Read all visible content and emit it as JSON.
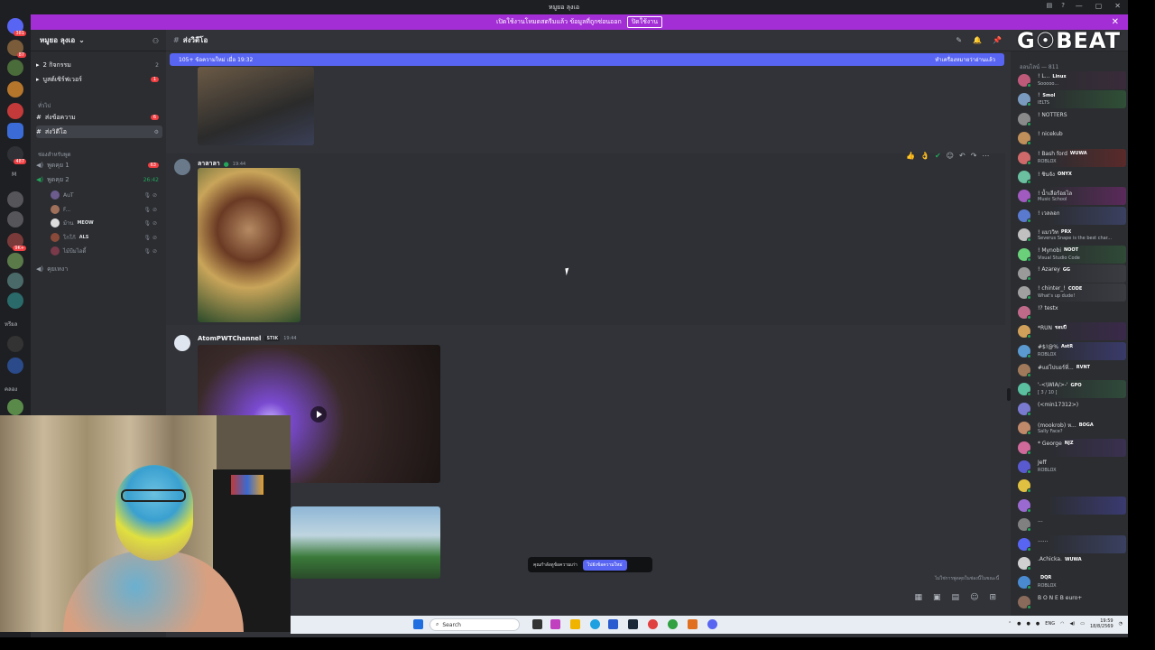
{
  "window": {
    "title": "หมูยอ ลุงเอ",
    "controls": [
      "—",
      "▢",
      "✕"
    ]
  },
  "banner": {
    "text": "เปิดใช้งานโหมดสตรีมแล้ว ข้อมูลที่ถูกซ่อนออก",
    "button": "ปิดใช้งาน",
    "close": "✕"
  },
  "guilds": {
    "badges": [
      "381",
      "87",
      "487",
      "9K+"
    ],
    "labels": [
      "M",
      "หรียล",
      "คลอง"
    ]
  },
  "server": {
    "name": "หมูยอ ลุงเอ",
    "rows": [
      {
        "label": "2 กิจกรรม",
        "badge": "2"
      },
      {
        "label": "บูสต์เซิร์ฟเวอร์",
        "badge": "1"
      }
    ],
    "category1": "ทั่วไป",
    "channels": [
      {
        "label": "ส่งข้อความ",
        "badge": "6"
      },
      {
        "label": "ส่งวิดีโอ"
      }
    ],
    "category2": "ช่องสำหรับพูด",
    "voice": [
      {
        "label": "พูดคุย 1",
        "badge": "63"
      },
      {
        "label": "พูดคุย 2",
        "time": "26:42"
      }
    ],
    "voice_users": [
      {
        "name": "AuT",
        "tag": ""
      },
      {
        "name": "F...",
        "tag": ""
      },
      {
        "name": "ม้าน",
        "tag": "MEOW"
      },
      {
        "name": "โกโก้",
        "tag": "ALS"
      },
      {
        "name": "ไม้บีมไอดี้",
        "tag": ""
      }
    ],
    "afk": "คุยเหงา"
  },
  "chat": {
    "channel": "ส่งวิดีโอ",
    "new_messages": "105+ ข้อความใหม่ เมื่อ 19:32",
    "mark_read": "ทำเครื่องหมายว่าอ่านแล้ว",
    "messages": [
      {
        "author": "ลาลาลา",
        "time": "19:44"
      },
      {
        "author": "AtomPWTChannel",
        "tag": "STIK",
        "time": "19:44"
      }
    ],
    "toast_text": "คุณกำลังดูข้อความเก่า",
    "toast_button": "ไปยังข้อความใหม่",
    "typing": "ไม่ใช่การพูดคุยในช่องนี้ในขณะนี้"
  },
  "logo": "G☉BEAT",
  "members": {
    "header": "ออนไลน์ — 811",
    "list": [
      {
        "name": "! L...",
        "tag": "Linux",
        "sub": "Sooooo...",
        "color": "#3a2b3a"
      },
      {
        "name": "!",
        "tag": "Smol",
        "sub": "IELTS",
        "color": "#2f4f36"
      },
      {
        "name": "! NOTTERS",
        "tag": "",
        "sub": "",
        "color": "#2b2d31"
      },
      {
        "name": "! nicekub",
        "tag": "",
        "sub": "",
        "color": "#2b2d31"
      },
      {
        "name": "! Bash ford",
        "tag": "WUWA",
        "sub": "ROBLOX",
        "color": "#5a2a2a"
      },
      {
        "name": "! ชินจัง",
        "tag": "ONYX",
        "sub": "",
        "color": "#2b2d31"
      },
      {
        "name": "! น้ำเลือร้อยไล",
        "tag": "",
        "sub": "Music School",
        "color": "#5a2a5a"
      },
      {
        "name": "! เวลลอก",
        "tag": "",
        "sub": "",
        "color": "#3a4060"
      },
      {
        "name": "! แมววิท",
        "tag": "PRX",
        "sub": "Severus Snape is the best char...",
        "color": "#2b2d31"
      },
      {
        "name": "! Mynobi",
        "tag": "NOOT",
        "sub": "Visual Studio Code",
        "color": "#2f4a36"
      },
      {
        "name": "! Azarey",
        "tag": "GG",
        "sub": "",
        "color": "#3a3c42"
      },
      {
        "name": "! chinter_!",
        "tag": "CODE",
        "sub": "What's up dude!",
        "color": "#3a3c42"
      },
      {
        "name": "!? testx",
        "tag": "",
        "sub": "",
        "color": "#2b2d31"
      },
      {
        "name": "*RUN",
        "tag": "ขอบปี",
        "sub": "",
        "color": "#3a2a4a"
      },
      {
        "name": "#$!@%",
        "tag": "AstR",
        "sub": "ROBLOX",
        "color": "#3a3a6a"
      },
      {
        "name": "#แย่โปบอร์ที่...",
        "tag": "RVNT",
        "sub": "",
        "color": "#2b2d31"
      },
      {
        "name": "'-<\\WIA/>-'",
        "tag": "GPO",
        "sub": "[ 3 / 10 ]",
        "color": "#2f4a3a"
      },
      {
        "name": "(<min17312>)",
        "tag": "",
        "sub": "",
        "color": "#2b2d31"
      },
      {
        "name": "(mookrob) ห...",
        "tag": "BOGA",
        "sub": "Sally Face?",
        "color": "#2b2d31"
      },
      {
        "name": "* George",
        "tag": "NJZ",
        "sub": "",
        "color": "#3a3050"
      },
      {
        "name": "Jeff",
        "tag": "",
        "sub": "ROBLOX",
        "color": "#2b2d31"
      },
      {
        "name": "",
        "tag": "",
        "sub": "",
        "color": "#2b2d31"
      },
      {
        "name": "",
        "tag": "",
        "sub": "",
        "color": "#3a3a70"
      },
      {
        "name": "...",
        "tag": "",
        "sub": "",
        "color": "#2b2d31"
      },
      {
        "name": "......",
        "tag": "",
        "sub": "",
        "color": "#3a4060"
      },
      {
        "name": ".Achicka.",
        "tag": "WUWA",
        "sub": "",
        "color": "#2b2d31"
      },
      {
        "name": "",
        "tag": "DQR",
        "sub": "ROBLOX",
        "color": "#2b2d31"
      },
      {
        "name": "B O N E B euro+",
        "tag": "",
        "sub": "",
        "color": "#2b2d31"
      }
    ]
  },
  "taskbar": {
    "search": "Search",
    "lang": "ENG",
    "time": "19:59",
    "date": "18/8/2569"
  }
}
